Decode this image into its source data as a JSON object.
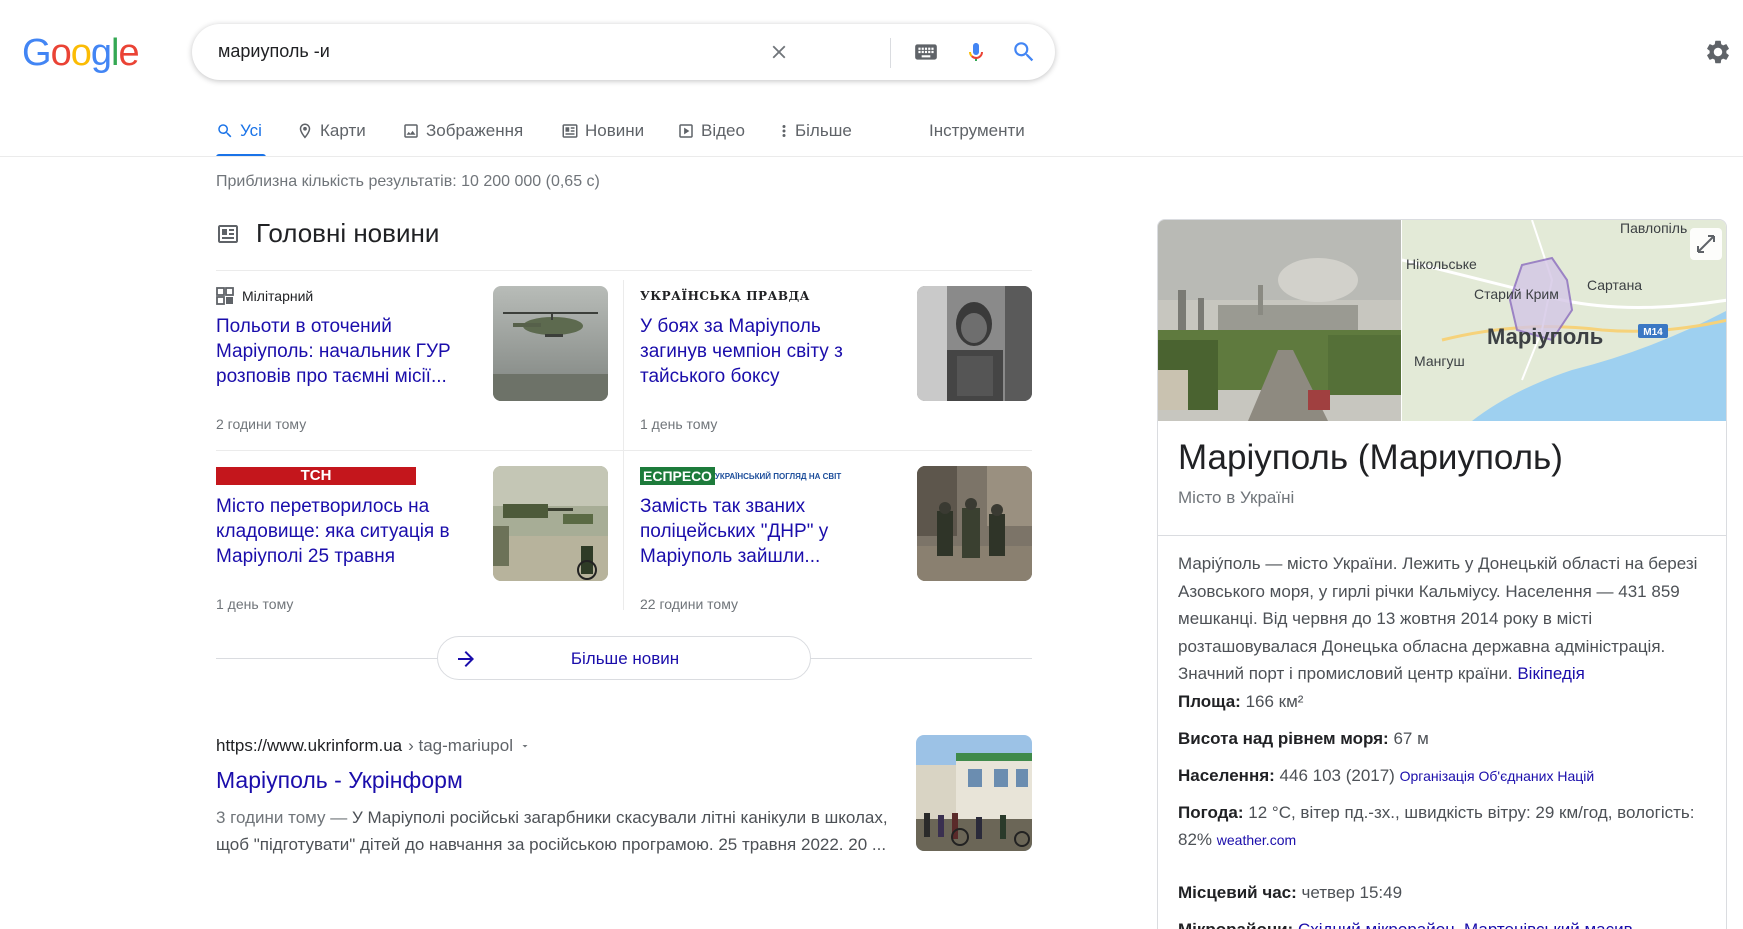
{
  "logo": {
    "letters": [
      "G",
      "o",
      "o",
      "g",
      "l",
      "e"
    ],
    "colors": [
      "#4285F4",
      "#EA4335",
      "#FBBC05",
      "#4285F4",
      "#34A853",
      "#EA4335"
    ]
  },
  "search": {
    "query": "мариуполь -и"
  },
  "tabs": [
    {
      "label": "Усі",
      "icon": "search-icon"
    },
    {
      "label": "Карти",
      "icon": "pin-icon"
    },
    {
      "label": "Зображення",
      "icon": "image-icon"
    },
    {
      "label": "Новини",
      "icon": "news-icon"
    },
    {
      "label": "Відео",
      "icon": "play-icon"
    },
    {
      "label": "Більше",
      "icon": "more-icon"
    }
  ],
  "tools_label": "Інструменти",
  "result_stats": "Приблизна кількість результатів: 10 200 000 (0,65 с)",
  "top_stories": {
    "title": "Головні новини",
    "items": [
      {
        "source": "Мілітарний",
        "headline": "Польоти в оточений Маріуполь: начальник ГУР розповів про таємні місії...",
        "time": "2 години тому"
      },
      {
        "source": "УКРАЇНСЬКА ПРАВДА",
        "headline": "У боях за Маріуполь загинув чемпіон світу з тайського боксу",
        "time": "1 день тому"
      },
      {
        "source": "ТСН",
        "headline": "Місто перетворилось на кладовище: яка ситуація в Маріуполі 25 травня",
        "time": "1 день тому"
      },
      {
        "source": "ЕСПРЕСО",
        "source_tagline": "УКРАЇНСЬКИЙ ПОГЛЯД НА СВІТ",
        "headline": "Замість так званих поліцейських \"ДНР\" у Маріуполь зайшли...",
        "time": "22 години тому"
      }
    ],
    "more_label": "Більше новин"
  },
  "result": {
    "domain": "https://www.ukrinform.ua",
    "path": " › tag-mariupol",
    "title": "Маріуполь - Укрінформ",
    "date": "3 години тому — ",
    "snippet": "У Маріуполі російські загарбники скасували літні канікули в школах, щоб \"підготувати\" дітей до навчання за російською програмою. 25 травня 2022. 20 ..."
  },
  "knowledge_panel": {
    "title": "Маріуполь (Мариуполь)",
    "subtitle": "Місто в Україні",
    "map_labels": {
      "city": "Маріуполь",
      "nikolske": "Нікольське",
      "staryi_krym": "Старий Крим",
      "sartana": "Сартана",
      "pavlopil": "Павлопіль",
      "manhush": "Мангуш",
      "road": "M14"
    },
    "description": "Маріу́поль — місто України. Лежить у Донецькій області на березі Азовського моря, у гирлі річки Кальміусу. Населення — 431 859 мешканці. Від червня до 13 жовтня 2014 року в місті розташовувалася Донецька обласна державна адміністрація. Значний порт і промисловий центр країни.",
    "wiki_link": "Вікіпедія",
    "facts": {
      "area_label": "Площа:",
      "area_value": "166 км²",
      "elev_label": "Висота над рівнем моря:",
      "elev_value": "67 м",
      "pop_label": "Населення:",
      "pop_value": "446 103 (2017)",
      "pop_source": "Організація Об'єднаних Націй",
      "weather_label": "Погода:",
      "weather_value": "12 °C, вітер пд.-зх., швидкість вітру: 29 км/год, вологість: 82%",
      "weather_source": "weather.com",
      "time_label": "Місцевий час:",
      "time_value": "четвер 15:49",
      "districts_label": "Мікрорайони:",
      "districts_value": "Східний мікрорайон, Мартенівський масив"
    }
  }
}
